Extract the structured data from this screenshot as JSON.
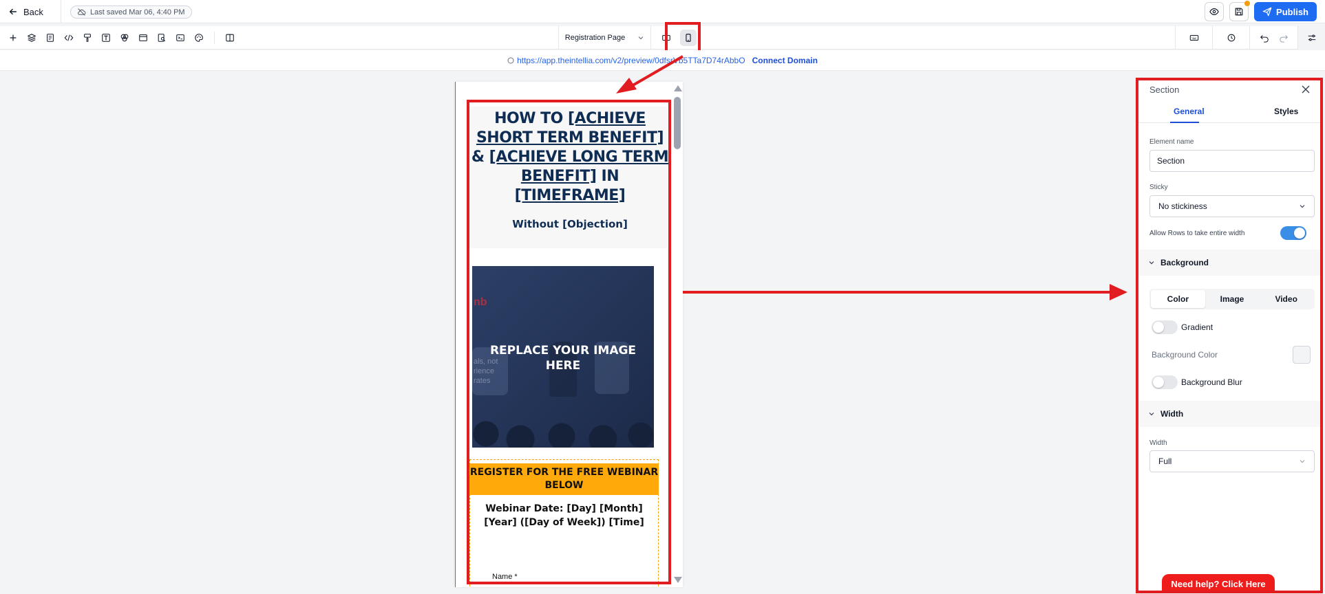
{
  "topbar": {
    "back_label": "Back",
    "saved_text": "Last saved Mar 06, 4:40 PM",
    "publish_label": "Publish"
  },
  "toolbar": {
    "page_name": "Registration Page"
  },
  "urlbar": {
    "preview_url": "https://app.theintellia.com/v2/preview/0dfsrVb5TTa7D74rAbbO",
    "connect_domain": "Connect Domain"
  },
  "preview": {
    "headline_1": "HOW TO ",
    "headline_2": "[ACHIEVE SHORT TERM BENEFIT]",
    "headline_3": " & ",
    "headline_4": "[ACHIEVE LONG TERM BENEFIT]",
    "headline_5": " IN ",
    "headline_6": "[TIMEFRAME]",
    "subheadline": "Without [Objection]",
    "image_placeholder": "REPLACE YOUR IMAGE HERE",
    "image_brand": "nb",
    "image_faint_1": "als, not",
    "image_faint_2": "rience",
    "image_faint_3": "rates",
    "register_banner": "REGISTER FOR THE FREE WEBINAR BELOW",
    "webinar_date": "Webinar Date: [Day] [Month] [Year] ([Day of Week]) [Time]",
    "name_label": "Name *"
  },
  "panel": {
    "title": "Section",
    "tab_general": "General",
    "tab_styles": "Styles",
    "element_name_label": "Element name",
    "element_name_value": "Section",
    "sticky_label": "Sticky",
    "sticky_value": "No stickiness",
    "allow_rows_label": "Allow Rows to take entire width",
    "allow_rows_on": true,
    "background_section": "Background",
    "bg_tabs": [
      "Color",
      "Image",
      "Video"
    ],
    "gradient_label": "Gradient",
    "bg_color_label": "Background Color",
    "bg_blur_label": "Background Blur",
    "width_section": "Width",
    "width_label": "Width",
    "width_value": "Full",
    "help_button": "Need help? Click Here"
  },
  "colors": {
    "accent": "#1d6cf2",
    "annotation_red": "#e11d22",
    "banner_orange": "#ffa90a",
    "headline_navy": "#0f2d52"
  }
}
